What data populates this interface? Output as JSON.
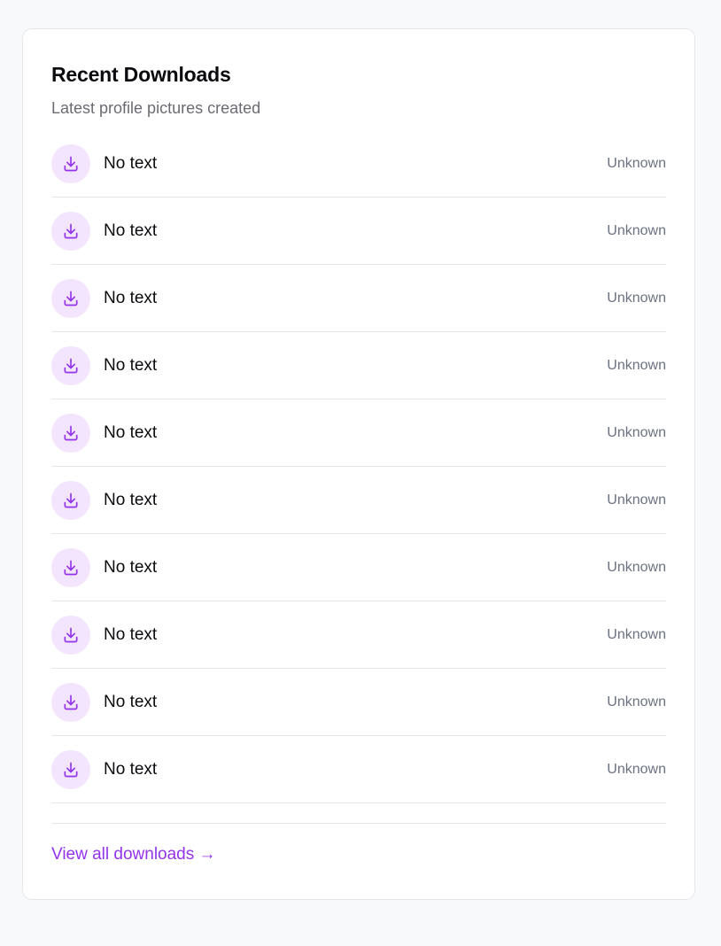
{
  "card": {
    "title": "Recent Downloads",
    "subtitle": "Latest profile pictures created"
  },
  "downloads": [
    {
      "label": "No text",
      "status": "Unknown",
      "icon": "download-icon"
    },
    {
      "label": "No text",
      "status": "Unknown",
      "icon": "download-icon"
    },
    {
      "label": "No text",
      "status": "Unknown",
      "icon": "download-icon"
    },
    {
      "label": "No text",
      "status": "Unknown",
      "icon": "download-icon"
    },
    {
      "label": "No text",
      "status": "Unknown",
      "icon": "download-icon"
    },
    {
      "label": "No text",
      "status": "Unknown",
      "icon": "download-icon"
    },
    {
      "label": "No text",
      "status": "Unknown",
      "icon": "download-icon"
    },
    {
      "label": "No text",
      "status": "Unknown",
      "icon": "download-icon"
    },
    {
      "label": "No text",
      "status": "Unknown",
      "icon": "download-icon"
    },
    {
      "label": "No text",
      "status": "Unknown",
      "icon": "download-icon"
    }
  ],
  "footer": {
    "view_all_label": "View all downloads →"
  },
  "colors": {
    "accent": "#9333ea",
    "icon_bg": "#f3e5fd",
    "muted_text": "#6b7280"
  }
}
